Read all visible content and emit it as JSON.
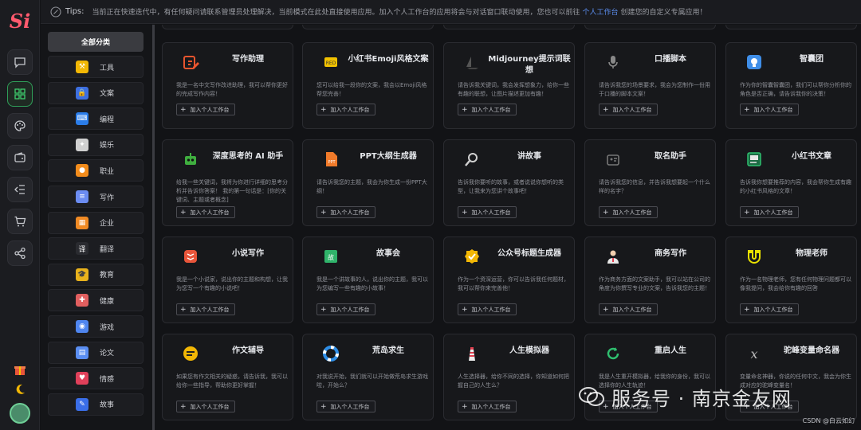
{
  "logo": {
    "text": "Si"
  },
  "rail": {
    "items": [
      {
        "icon": "chat-icon"
      },
      {
        "icon": "grid-icon",
        "active": true
      },
      {
        "icon": "palette-icon"
      },
      {
        "icon": "wallet-icon"
      },
      {
        "icon": "list-collapse-icon"
      },
      {
        "icon": "cart-icon"
      },
      {
        "icon": "share-icon"
      }
    ]
  },
  "tips": {
    "label": "Tips:",
    "text": "当前正在快速迭代中，有任何疑问请联系管理员处理解决，当前模式在此处直接使用应用。加入个人工作台的应用将会与对话窗口联动使用，您也可以前往",
    "link": "个人工作台",
    "text2": "创建您的自定义专属应用！"
  },
  "categories": {
    "all_label": "全部分类",
    "items": [
      {
        "label": "工具",
        "color": "#f2b705",
        "glyph": "⚒"
      },
      {
        "label": "文案",
        "color": "#3d6fe0",
        "glyph": "🔒"
      },
      {
        "label": "编程",
        "color": "#2b7de9",
        "glyph": "⌨"
      },
      {
        "label": "娱乐",
        "color": "#d0d0d0",
        "glyph": "✦"
      },
      {
        "label": "职业",
        "color": "#f28c1c",
        "glyph": "●"
      },
      {
        "label": "写作",
        "color": "#6b8cf2",
        "glyph": "≡"
      },
      {
        "label": "企业",
        "color": "#f08a24",
        "glyph": "▦"
      },
      {
        "label": "翻译",
        "color": "#2a2b30",
        "glyph": "译"
      },
      {
        "label": "教育",
        "color": "#e8b21c",
        "glyph": "🎓"
      },
      {
        "label": "健康",
        "color": "#e15f5f",
        "glyph": "✚"
      },
      {
        "label": "游戏",
        "color": "#4f86f0",
        "glyph": "◉"
      },
      {
        "label": "论文",
        "color": "#5a8ef2",
        "glyph": "▤"
      },
      {
        "label": "情感",
        "color": "#e0405a",
        "glyph": "♥"
      },
      {
        "label": "故事",
        "color": "#3a6ee8",
        "glyph": "✎"
      }
    ]
  },
  "button_label": "加入个人工作台",
  "plus": "+",
  "cards": [
    {
      "title": "写作助理",
      "desc": "我是一名中文写作改进助理，我可以帮你更好的完成写作内容！",
      "icon": "pencil-icon",
      "color": "#e8552e"
    },
    {
      "title": "小红书Emoji风格文案",
      "desc": "您可以给我一段你的文案，我会以Emoji风格帮您完善！",
      "icon": "emoji-note-icon",
      "color": "#f2c200"
    },
    {
      "title": "Midjourney提示词联想",
      "desc": "请告诉我关键词，我会发挥想象力，给你一些有趣的联想，让图片描述更加有趣！",
      "icon": "sail-icon",
      "color": "#333333"
    },
    {
      "title": "口播脚本",
      "desc": "请告诉我您的场景要求，我会为您制作一份用于口播的脚本文案！",
      "icon": "microphone-icon",
      "color": "#2a2a2a"
    },
    {
      "title": "智囊团",
      "desc": "作为你的智囊智囊团，我们可以帮你分析你的角色是否正确，请告诉我你的决策！",
      "icon": "bulb-icon",
      "color": "#3f8ee8"
    },
    {
      "title": "深度思考的 AI 助手",
      "desc": "给我一些关键词，我将为你进行详细的思考分析并告诉你答案！ 我的第一句话是：[你的关键词、主题或者概念]",
      "icon": "robot-icon",
      "color": "#3fae3f"
    },
    {
      "title": "PPT大纲生成器",
      "desc": "请告诉我您的主题，我会为你生成一份PPT大纲！",
      "icon": "ppt-icon",
      "color": "#f07a2a"
    },
    {
      "title": "讲故事",
      "desc": "告诉我你要听的故事，或者说说你想听的类型，让我来为您讲个故事吧！",
      "icon": "magnifier-icon",
      "color": "#d0d0d0"
    },
    {
      "title": "取名助手",
      "desc": "请告诉我您的信息，并告诉我想要起一个什么样的名字？",
      "icon": "name-tag-icon",
      "color": "#555555"
    },
    {
      "title": "小红书文章",
      "desc": "告诉我你想要推荐的内容，我会帮你生成有趣的小红书风格的文章！",
      "icon": "note-book-icon",
      "color": "#2fbf6f"
    },
    {
      "title": "小说写作",
      "desc": "我是一个小说家，说出你的主题和构想，让我为您写一个有趣的小说吧！",
      "icon": "novel-icon",
      "color": "#e8553a"
    },
    {
      "title": "故事会",
      "desc": "我是一个讲故事的人，说出你的主题，我可以为您编写一些有趣的小故事！",
      "icon": "story-book-icon",
      "color": "#2fb36a"
    },
    {
      "title": "公众号标题生成器",
      "desc": "作为一个资深运营，你可以告诉我任何题材，我可以帮你来完善他！",
      "icon": "badge-check-icon",
      "color": "#f2b705"
    },
    {
      "title": "商务写作",
      "desc": "作为商务方面的文案助手，我可以站在公司的角度为你撰写专业的文案，告诉我您的主题！",
      "icon": "businessman-icon",
      "color": "#e0e0e0"
    },
    {
      "title": "物理老师",
      "desc": "作为一名物理老师，您有任何物理问题都可以像我提问，我会给你有趣的回答",
      "icon": "magnet-icon",
      "color": "#e8e000"
    },
    {
      "title": "作文辅导",
      "desc": "如果您有作文相关的疑惑，请告诉我，我可以给你一些指导，帮助你更好掌握！",
      "icon": "speech-icon",
      "color": "#f2b705"
    },
    {
      "title": "荒岛求生",
      "desc": "对我说开始，我们就可以开始做荒岛求生游戏啦，开始么？",
      "icon": "lifebuoy-icon",
      "color": "#2f8fe8"
    },
    {
      "title": "人生模拟器",
      "desc": "人生选择器，给你不同的选择，你知道如何把握自己的人生么？",
      "icon": "lighthouse-icon",
      "color": "#e04050"
    },
    {
      "title": "重启人生",
      "desc": "我是人生重开模拟器，给我你的身份，我可以选择你的人生轨迹！",
      "icon": "restart-icon",
      "color": "#2fbf6f"
    },
    {
      "title": "驼峰变量命名器",
      "desc": "变量命名神器，你说的任何中文，我会为你生成对应的驼峰变量名！",
      "icon": "variable-icon",
      "color": "#bbbbbb"
    }
  ],
  "watermark": {
    "text": "服务号 · 南京金友网",
    "csdn": "CSDN @白云如幻"
  }
}
